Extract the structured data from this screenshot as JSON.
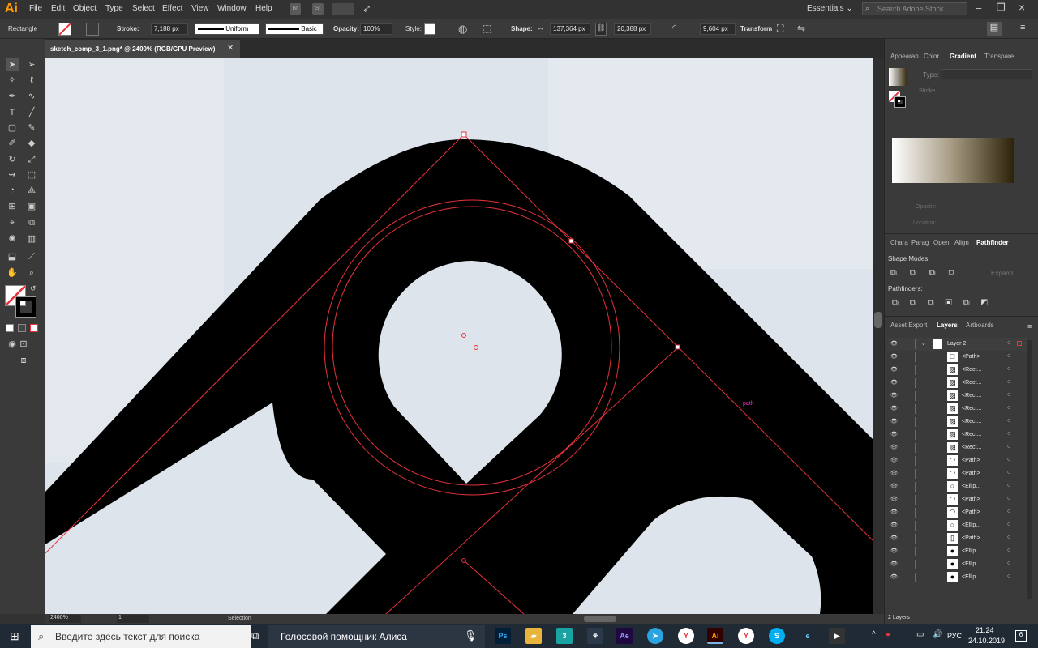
{
  "app": {
    "logo": "Ai",
    "workspace": "Essentials",
    "search_placeholder": "Search Adobe Stock"
  },
  "menu": [
    "File",
    "Edit",
    "Object",
    "Type",
    "Select",
    "Effect",
    "View",
    "Window",
    "Help"
  ],
  "menu_buttons": [
    "Br",
    "St"
  ],
  "control": {
    "object_type": "Rectangle",
    "stroke_label": "Stroke:",
    "stroke_value": "7,188 px",
    "stroke_profile": "Uniform",
    "brush": "Basic",
    "opacity_label": "Opacity:",
    "opacity_value": "100%",
    "style_label": "Style:",
    "shape_label": "Shape:",
    "width": "137,364 px",
    "height": "20,388 px",
    "corner": "9,604 px",
    "transform": "Transform"
  },
  "document": {
    "tab_title": "sketch_comp_3_1.png* @ 2400% (RGB/GPU Preview)",
    "canvas_label": "path"
  },
  "status": {
    "zoom": "2400%",
    "artboard": "1",
    "tool": "Selection"
  },
  "panels": {
    "top_tabs": [
      "Appearan",
      "Color",
      "Gradient",
      "Transpare"
    ],
    "active_top_tab": "Gradient",
    "gradient": {
      "type_label": "Type:",
      "stroke_label": "Stroke",
      "opacity_label": "Opacity:",
      "location_label": "Location:"
    },
    "mid_tabs": [
      "Chara",
      "Parag",
      "Open",
      "Align",
      "Pathfinder"
    ],
    "active_mid_tab": "Pathfinder",
    "pathfinder": {
      "shape_modes": "Shape Modes:",
      "pathfinders": "Pathfinders:",
      "expand": "Expand"
    },
    "layer_tabs": [
      "Asset Export",
      "Layers",
      "Artboards"
    ],
    "active_layer_tab": "Layers",
    "layer_name": "Layer 2",
    "layers": [
      "<Path>",
      "<Rect...",
      "<Rect...",
      "<Rect...",
      "<Rect...",
      "<Rect...",
      "<Rect...",
      "<Rect...",
      "<Path>",
      "<Path>",
      "<Ellip...",
      "<Path>",
      "<Path>",
      "<Ellip...",
      "<Path>",
      "<Ellip...",
      "<Ellip...",
      "<Ellip..."
    ],
    "layer_count": "2 Layers"
  },
  "taskbar": {
    "search_placeholder": "Введите здесь текст для поиска",
    "assistant": "Голосовой помощник Алиса",
    "apps": [
      "Ps",
      "3",
      "Ae",
      "Ai"
    ],
    "lang": "РУС",
    "time": "21:24",
    "date": "24.10.2019",
    "notifications": "6"
  },
  "colors": {
    "accent": "#ff9a00",
    "selection": "#e8323c",
    "canvas_bg": "#dde4eb"
  }
}
